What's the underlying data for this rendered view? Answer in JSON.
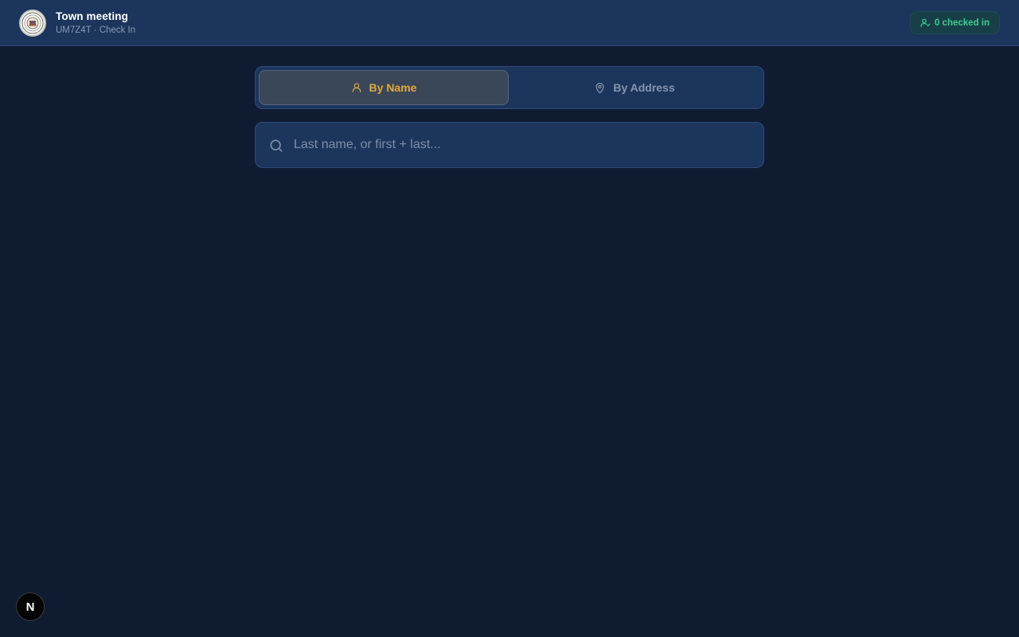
{
  "header": {
    "title": "Town meeting",
    "subtitle": "UM7Z4T · Check In",
    "seal_icon": "town-seal",
    "checked_in_label": "0 checked in"
  },
  "tabs": [
    {
      "label": "By Name",
      "icon": "person-icon",
      "active": true
    },
    {
      "label": "By Address",
      "icon": "map-pin-icon",
      "active": false
    }
  ],
  "search": {
    "placeholder": "Last name, or first + last...",
    "value": ""
  },
  "dev_tools": {
    "label": "N"
  },
  "colors": {
    "background": "#0f1b31",
    "panel": "#1c355c",
    "accent": "#e2a93a",
    "success": "#3ccf8e"
  }
}
